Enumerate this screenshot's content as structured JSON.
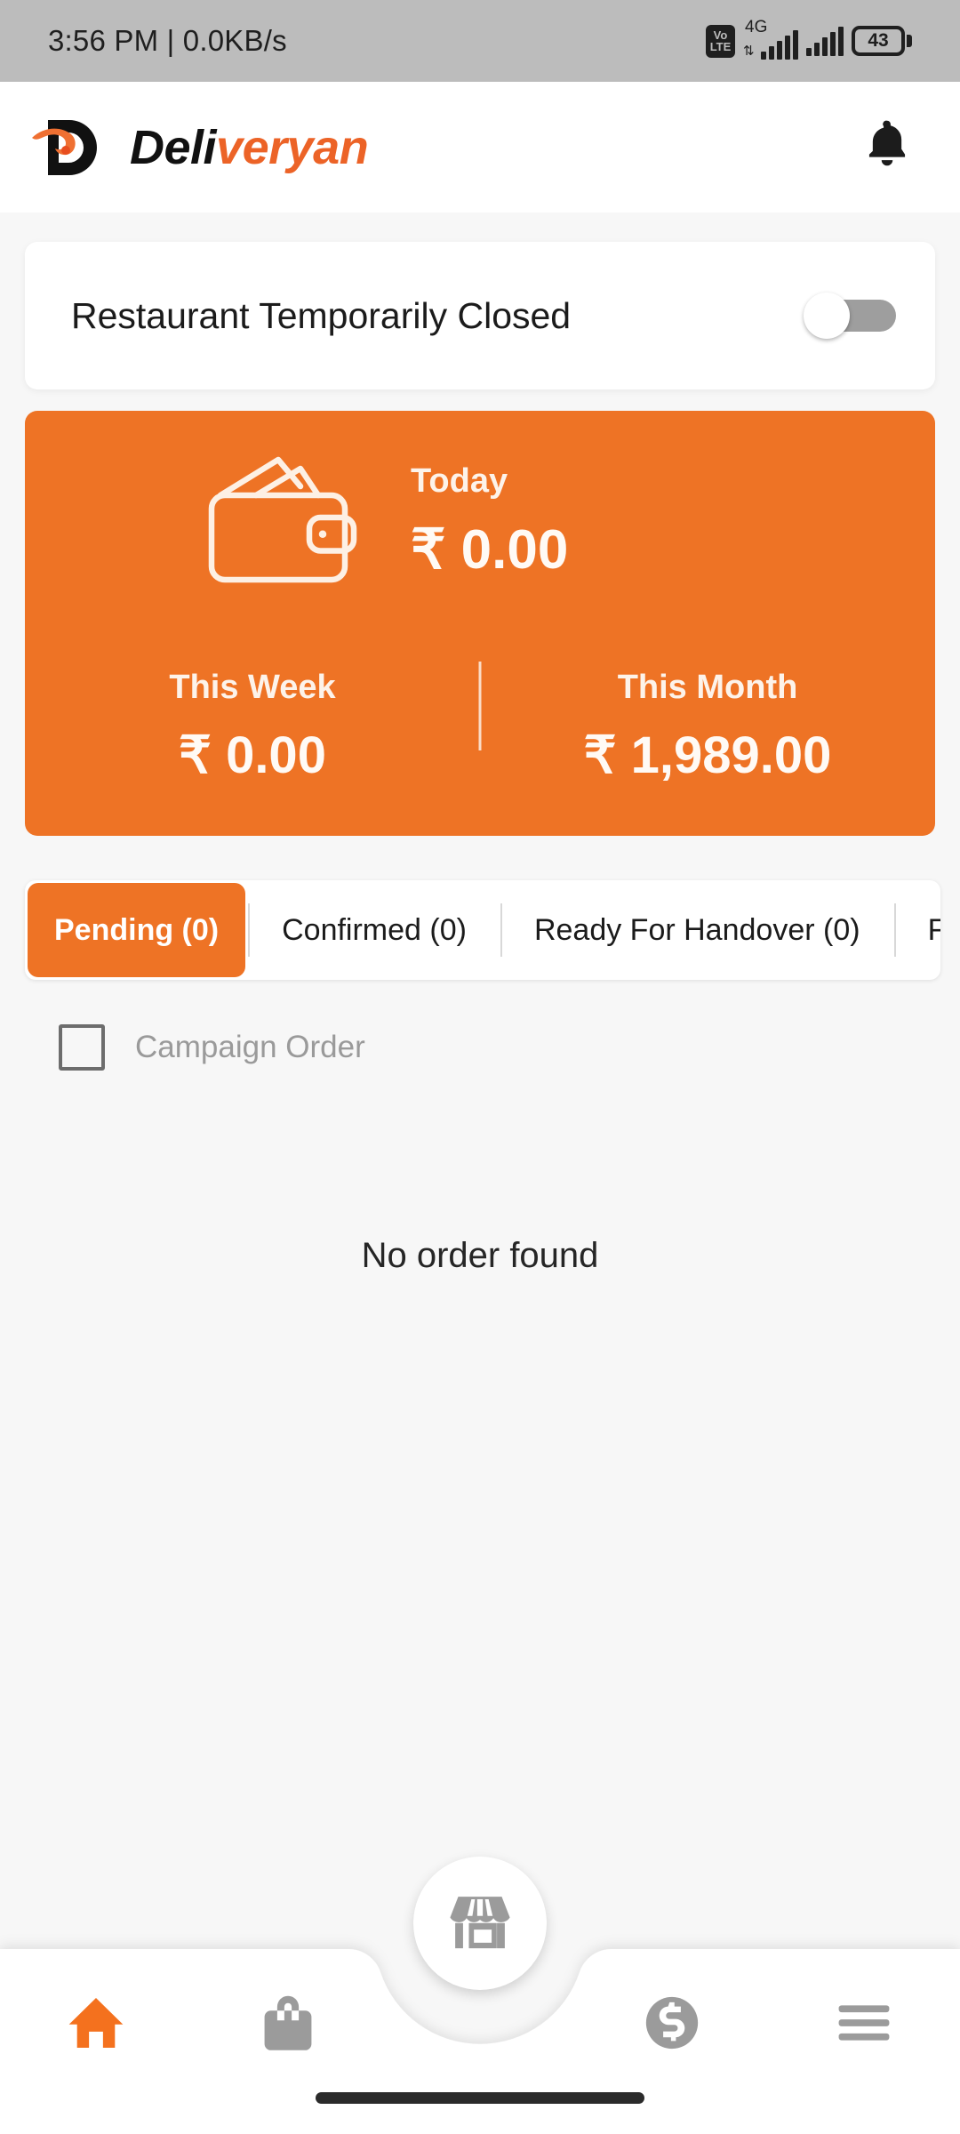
{
  "status_bar": {
    "time_and_net": "3:56 PM | 0.0KB/s",
    "volte_top": "Vo",
    "volte_bottom": "LTE",
    "network_type": "4G",
    "data_arrows": "⇅",
    "battery_level": "43"
  },
  "app_bar": {
    "logo_letter": "D",
    "brand_black": "Deli",
    "brand_orange": "veryan",
    "notification_icon": "bell-icon"
  },
  "restaurant_status": {
    "label": "Restaurant Temporarily Closed",
    "toggle_state": "off"
  },
  "earnings": {
    "wallet_icon": "wallet-icon",
    "today": {
      "label": "Today",
      "amount": "₹ 0.00"
    },
    "this_week": {
      "label": "This Week",
      "amount": "₹ 0.00"
    },
    "this_month": {
      "label": "This Month",
      "amount": "₹ 1,989.00"
    }
  },
  "tabs": {
    "active_index": 0,
    "items": [
      {
        "label": "Pending (0)"
      },
      {
        "label": "Confirmed (0)"
      },
      {
        "label": "Ready For Handover (0)"
      },
      {
        "label": "Food On T"
      }
    ]
  },
  "filters": {
    "campaign_order_label": "Campaign Order",
    "campaign_order_checked": "false"
  },
  "order_list": {
    "empty_message": "No order found"
  },
  "bottom_nav": {
    "items": [
      {
        "name": "home",
        "icon": "home-icon",
        "active": "true"
      },
      {
        "name": "orders",
        "icon": "shopping-bag-icon",
        "active": "false"
      },
      {
        "name": "store",
        "icon": "storefront-icon",
        "active": "false"
      },
      {
        "name": "earnings",
        "icon": "dollar-circle-icon",
        "active": "false"
      },
      {
        "name": "menu",
        "icon": "hamburger-menu-icon",
        "active": "false"
      }
    ]
  },
  "colors": {
    "accent_orange": "#ee7325",
    "logo_orange": "#ec6327",
    "status_bar_grey": "#bcbcbc",
    "page_background": "#f7f7f7",
    "muted_grey": "#9a9a9a"
  }
}
